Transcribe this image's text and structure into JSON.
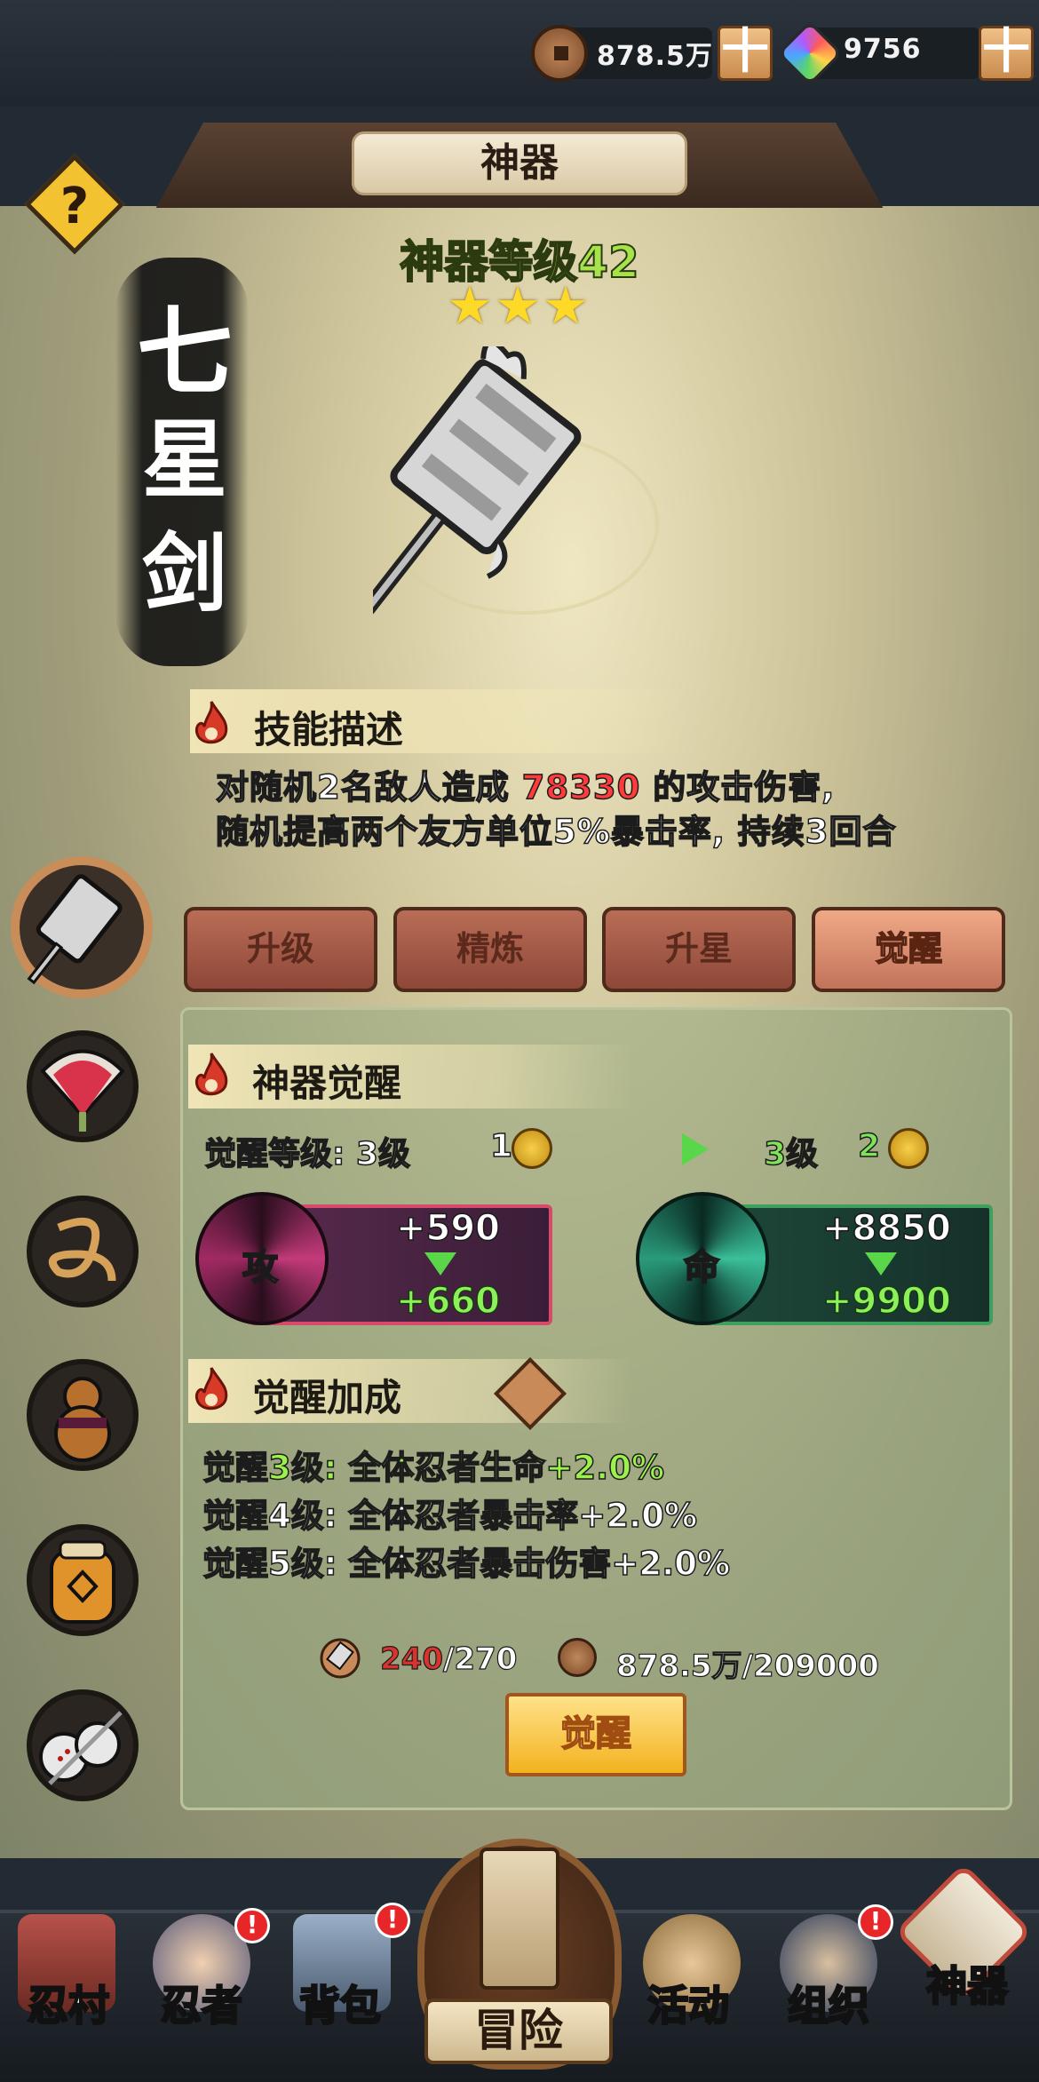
{
  "currency": {
    "coins": "878.5万",
    "gems": "9756",
    "plus_label": "十"
  },
  "header": {
    "title": "神器",
    "help_label": "?"
  },
  "artifact": {
    "name_chars": [
      "七",
      "星",
      "剑"
    ],
    "level_text": "神器等级42",
    "stars": 3
  },
  "skill": {
    "section_title": "技能描述",
    "line1_prefix": "对随机2名敌人造成 ",
    "line1_damage": "78330",
    "line1_suffix": " 的攻击伤害,",
    "line2": "随机提高两个友方单位5%暴击率, 持续3回合"
  },
  "tabs": [
    {
      "label": "升级",
      "selected": false
    },
    {
      "label": "精炼",
      "selected": false
    },
    {
      "label": "升星",
      "selected": false
    },
    {
      "label": "觉醒",
      "selected": true
    }
  ],
  "awaken": {
    "section_title": "神器觉醒",
    "level_label": "觉醒等级: 3级",
    "current_count": "1",
    "next_level": "3级",
    "next_count": "2",
    "attack": {
      "letter": "攻",
      "current": "+590",
      "next": "+660"
    },
    "life": {
      "letter": "命",
      "current": "+8850",
      "next": "+9900"
    }
  },
  "bonus": {
    "section_title": "觉醒加成",
    "lines": [
      {
        "text": "觉醒3级: 全体忍者生命+2.0%",
        "active": true
      },
      {
        "text": "觉醒4级: 全体忍者暴击率+2.0%",
        "active": false
      },
      {
        "text": "觉醒5级: 全体忍者暴击伤害+2.0%",
        "active": false
      }
    ]
  },
  "cost": {
    "material_have": "240",
    "material_need": "/270",
    "coins_text": "878.5万/209000"
  },
  "action_button": "觉醒",
  "nav": {
    "village": "忍村",
    "ninja": "忍者",
    "bag": "背包",
    "adventure": "冒险",
    "activity": "活动",
    "guild": "组织",
    "artifact": "神器",
    "badge": "!"
  },
  "colors": {
    "level_green": "#a6e34a",
    "damage_red": "#ff3b3b",
    "bonus_active": "#9cf24a",
    "stat_green": "#59d64a",
    "material_red": "#d8332e"
  }
}
